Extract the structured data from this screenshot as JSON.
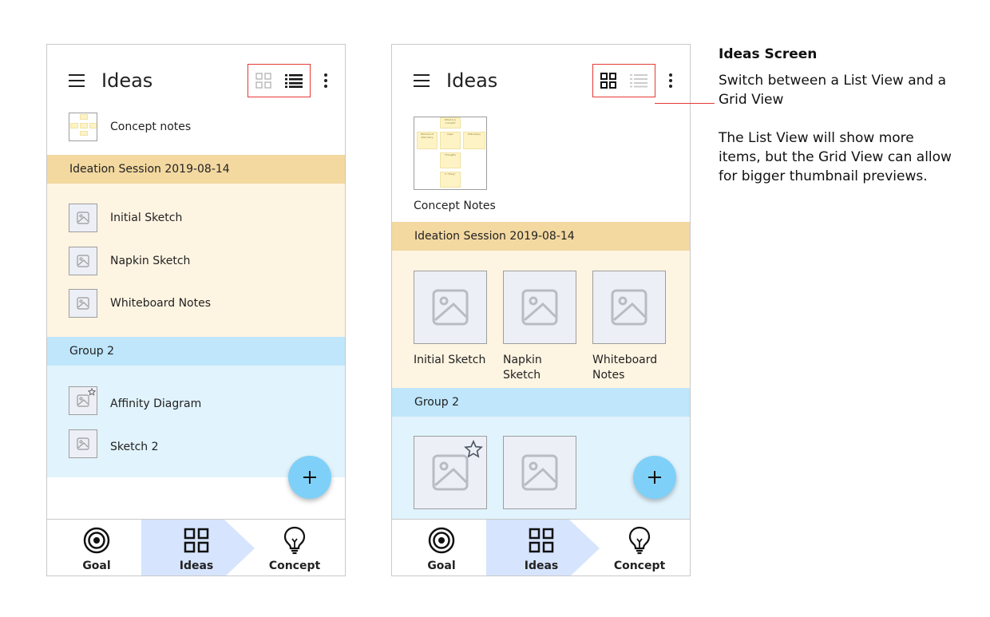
{
  "screen_title": "Ideas",
  "colors": {
    "accent_red": "#e53935",
    "group_yellow_header": "#f3d8a0",
    "group_yellow_body": "#fef4e2",
    "group_blue_header": "#bfe6fb",
    "group_blue_body": "#e1f3fc",
    "fab": "#7fd0f8",
    "nav_active": "#d6e4fd"
  },
  "list_screen": {
    "active_view": "list",
    "concept_item": {
      "label": "Concept notes"
    },
    "groups": [
      {
        "title": "Ideation Session 2019-08-14",
        "items": [
          {
            "label": "Initial Sketch",
            "icon": "image-placeholder-icon",
            "starred": false
          },
          {
            "label": "Napkin Sketch",
            "icon": "image-placeholder-icon",
            "starred": false
          },
          {
            "label": "Whiteboard Notes",
            "icon": "image-placeholder-icon",
            "starred": false
          }
        ]
      },
      {
        "title": "Group 2",
        "items": [
          {
            "label": "Affinity Diagram",
            "icon": "image-placeholder-icon",
            "starred": true
          },
          {
            "label": "Sketch 2",
            "icon": "image-placeholder-icon",
            "starred": false
          }
        ]
      }
    ]
  },
  "grid_screen": {
    "active_view": "grid",
    "concept_item": {
      "label": "Concept Notes",
      "stickies": [
        "What is a concept?",
        "Moment of Discovery",
        "Inspo",
        "Philosophy",
        "Thoughts",
        "A \"thing\""
      ]
    },
    "groups": [
      {
        "title": "Ideation Session 2019-08-14",
        "items": [
          {
            "label": "Initial Sketch",
            "starred": false
          },
          {
            "label": "Napkin Sketch",
            "starred": false
          },
          {
            "label": "Whiteboard Notes",
            "starred": false
          }
        ]
      },
      {
        "title": "Group 2",
        "items": [
          {
            "label": "",
            "starred": true
          },
          {
            "label": "",
            "starred": false
          }
        ]
      }
    ]
  },
  "bottom_nav": [
    {
      "label": "Goal",
      "icon": "target-icon",
      "active": false
    },
    {
      "label": "Ideas",
      "icon": "grid-icon",
      "active": true
    },
    {
      "label": "Concept",
      "icon": "lightbulb-icon",
      "active": false
    }
  ],
  "fab": {
    "icon": "plus-icon"
  },
  "annotation": {
    "title": "Ideas Screen",
    "subtitle": "Switch between a List View and a Grid View",
    "description": "The List View will show more items, but the Grid View can allow for bigger thumbnail previews."
  }
}
